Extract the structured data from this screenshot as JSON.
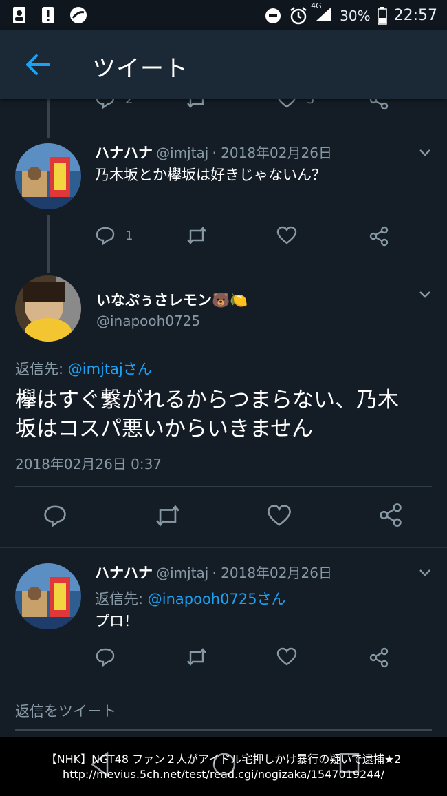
{
  "status_bar": {
    "battery": "30%",
    "time": "22:57",
    "network": "4G"
  },
  "header": {
    "title": "ツイート"
  },
  "top_partial_actions": {
    "reply_count": "2",
    "like_count": "5"
  },
  "tweet1": {
    "display_name": "ハナハナ",
    "handle": "@imjtaj",
    "date": "· 2018年02月26日",
    "text": "乃木坂とか欅坂は好きじゃないん？",
    "reply_count": "1"
  },
  "main_tweet": {
    "display_name": "いなぷぅさレモン🐻🍋",
    "handle": "@inapooh0725",
    "reply_to_prefix": "返信先: ",
    "reply_to_handle": "@imjtajさん",
    "text_line1": "欅はすぐ繋がれるからつまらない、乃木",
    "text_line2": "坂はコスパ悪いからいきません",
    "timestamp": "2018年02月26日 0:37"
  },
  "tweet3": {
    "display_name": "ハナハナ",
    "handle": "@imjtaj",
    "date": "· 2018年02月26日",
    "reply_to_prefix": "返信先: ",
    "reply_to_handle": "@inapooh0725さん",
    "text": "プロ！"
  },
  "reply_bar": {
    "placeholder": "返信をツイート"
  },
  "overlay_caption": {
    "line1": "【NHK】NGT48 ファン２人がアイドル宅押しかけ暴行の疑いで逮捕★2",
    "line2": "http://mevius.5ch.net/test/read.cgi/nogizaka/1547019244/"
  },
  "colors": {
    "background": "#141d26",
    "accent": "#1da1f2",
    "muted": "#8899a6"
  }
}
